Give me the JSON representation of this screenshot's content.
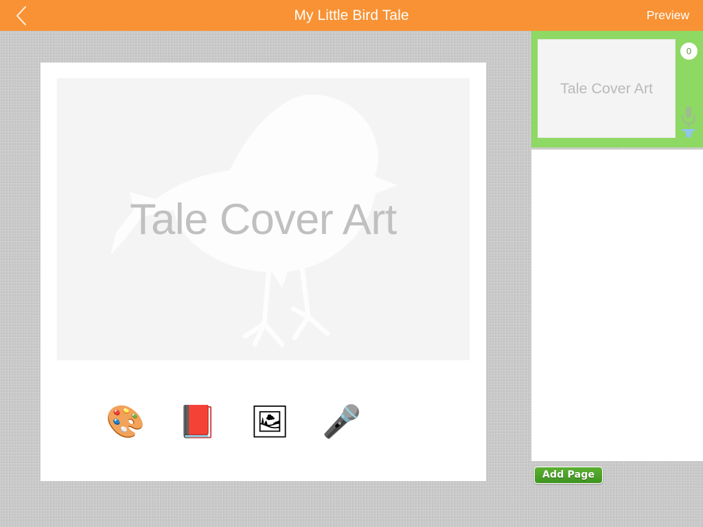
{
  "topbar": {
    "title": "My Little Bird Tale",
    "back_icon": "chevron-left-icon",
    "preview_label": "Preview",
    "background_color": "#f89234",
    "text_color": "#ffffff"
  },
  "page_card": {
    "cover_art": {
      "placeholder_label": "Tale Cover Art",
      "watermark_icon": "bird-silhouette-icon",
      "background_color": "#f4f4f4",
      "placeholder_color": "#c0c0c0"
    },
    "tools": [
      {
        "name": "draw-tool",
        "icon": "artist-palette-icon",
        "emoji": "🎨"
      },
      {
        "name": "text-tool",
        "icon": "closed-book-icon",
        "emoji": "📕"
      },
      {
        "name": "photo-tool",
        "icon": "photo-upload-icon",
        "emoji": "🖼"
      },
      {
        "name": "record-tool",
        "icon": "microphone-icon",
        "emoji": "🎤"
      }
    ]
  },
  "sidebar": {
    "selected_page": {
      "thumbnail_label": "Tale Cover Art",
      "page_number_badge": "0",
      "mic_icon": "microphone-icon",
      "highlight_color": "#8ed864",
      "badge_text_color": "#5d9a39"
    },
    "list_background_color": "#ffffff"
  },
  "add_page": {
    "label": "Add Page",
    "color": "#4ca429"
  },
  "background": {
    "texture": "linen",
    "color": "#c8c8c8"
  }
}
